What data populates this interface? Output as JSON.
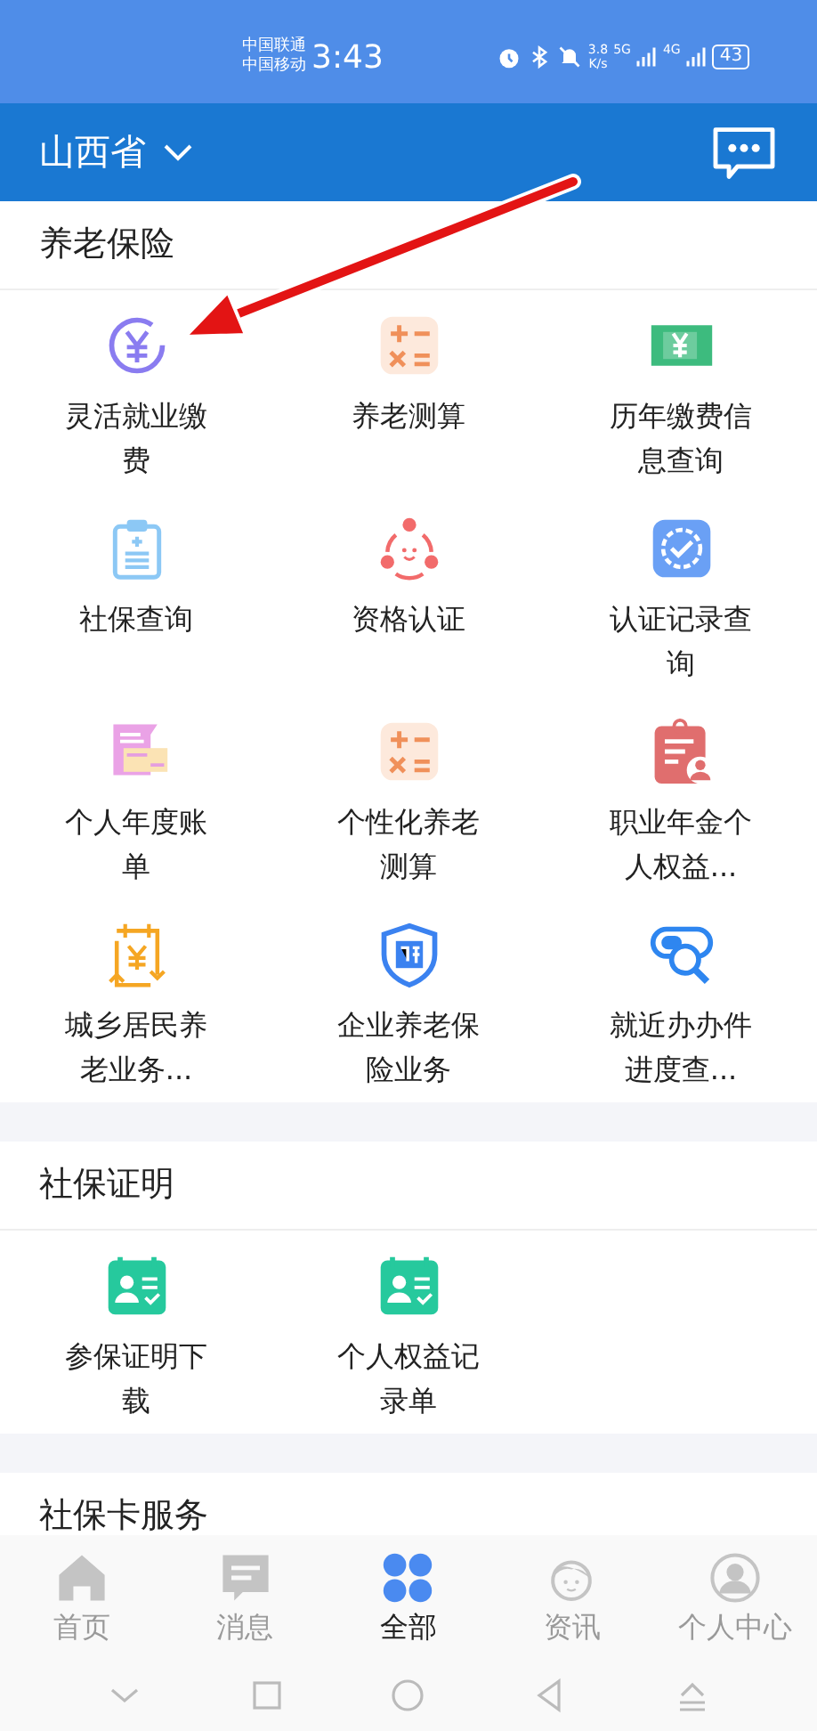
{
  "status_bar": {
    "carriers": [
      "中国联通",
      "中国移动"
    ],
    "time": "3:43",
    "speed": "3.8",
    "speed_unit": "K/s",
    "networks": [
      "5G",
      "4G"
    ],
    "battery": "43"
  },
  "header": {
    "province": "山西省"
  },
  "sections": [
    {
      "title": "养老保险",
      "items": [
        {
          "label": "灵活就业缴费"
        },
        {
          "label": "养老测算"
        },
        {
          "label": "历年缴费信息查询"
        },
        {
          "label": "社保查询"
        },
        {
          "label": "资格认证"
        },
        {
          "label": "认证记录查询"
        },
        {
          "label": "个人年度账单"
        },
        {
          "label": "个性化养老测算"
        },
        {
          "label": "职业年金个人权益..."
        },
        {
          "label": "城乡居民养老业务..."
        },
        {
          "label": "企业养老保险业务"
        },
        {
          "label": "就近办办件进度查..."
        }
      ]
    },
    {
      "title": "社保证明",
      "items": [
        {
          "label": "参保证明下载"
        },
        {
          "label": "个人权益记录单"
        }
      ]
    },
    {
      "title": "社保卡服务"
    }
  ],
  "tabs": [
    {
      "label": "首页",
      "selected": false
    },
    {
      "label": "消息",
      "selected": false
    },
    {
      "label": "全部",
      "selected": true
    },
    {
      "label": "资讯",
      "selected": false
    },
    {
      "label": "个人中心",
      "selected": false
    }
  ]
}
